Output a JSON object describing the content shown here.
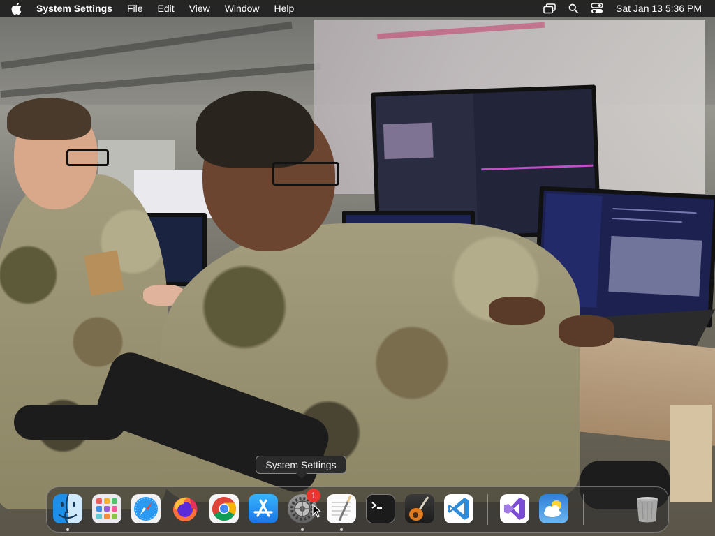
{
  "menubar": {
    "app_name": "System Settings",
    "menus": [
      "File",
      "Edit",
      "View",
      "Window",
      "Help"
    ],
    "clock": "Sat Jan 13  5:36 PM"
  },
  "tooltip": {
    "text": "System Settings"
  },
  "dock": {
    "apps": [
      {
        "name": "Finder",
        "running": true
      },
      {
        "name": "Launchpad",
        "running": false
      },
      {
        "name": "Safari",
        "running": false
      },
      {
        "name": "Firefox",
        "running": false
      },
      {
        "name": "Google Chrome",
        "running": false
      },
      {
        "name": "App Store",
        "running": false
      },
      {
        "name": "System Settings",
        "running": true,
        "badge": "1"
      },
      {
        "name": "TextEdit",
        "running": true
      },
      {
        "name": "Terminal",
        "running": false
      },
      {
        "name": "GarageBand",
        "running": false
      },
      {
        "name": "Visual Studio Code",
        "running": false
      },
      {
        "name": "Visual Studio",
        "running": false
      },
      {
        "name": "Weather",
        "running": false
      },
      {
        "name": "Trash",
        "running": false
      }
    ],
    "settings_badge": "1"
  },
  "colors": {
    "menubar_bg": "#1e1e1e",
    "badge": "#e8362f",
    "vscode": "#2f8cd9",
    "chrome_red": "#db4437"
  }
}
